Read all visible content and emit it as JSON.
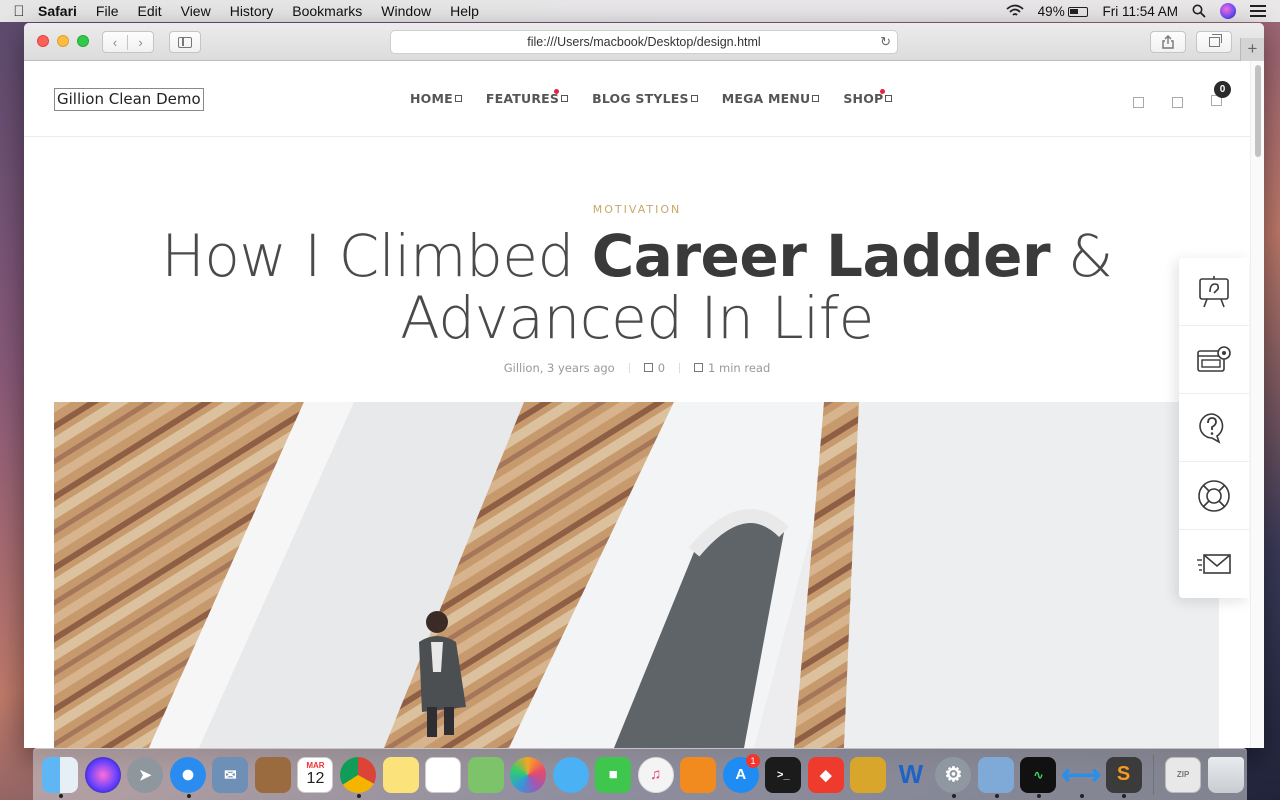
{
  "menubar": {
    "app_name": "Safari",
    "items": [
      "File",
      "Edit",
      "View",
      "History",
      "Bookmarks",
      "Window",
      "Help"
    ],
    "battery": "49%",
    "clock": "Fri 11:54 AM"
  },
  "browser": {
    "url": "file:///Users/macbook/Desktop/design.html"
  },
  "site": {
    "logo_text": "Gillion Clean Demo",
    "nav": [
      {
        "label": "HOME"
      },
      {
        "label": "FEATURES"
      },
      {
        "label": "BLOG STYLES"
      },
      {
        "label": "MEGA MENU"
      },
      {
        "label": "SHOP"
      }
    ],
    "cart_count": "0"
  },
  "post": {
    "category": "MOTIVATION",
    "title_part1": "How I Climbed",
    "title_bold": "Career Ladder",
    "title_part2": "&",
    "title_line2": "Advanced In Life",
    "author_time": "Gillion, 3 years ago",
    "comments": "0",
    "read_time": "1 min read"
  },
  "side_panel": {
    "items": [
      "presentation-icon",
      "browser-settings-icon",
      "help-chat-icon",
      "lifebuoy-icon",
      "mail-icon"
    ]
  },
  "dock": {
    "app_store_badge": "1",
    "calendar_month": "MAR",
    "calendar_day": "12"
  }
}
